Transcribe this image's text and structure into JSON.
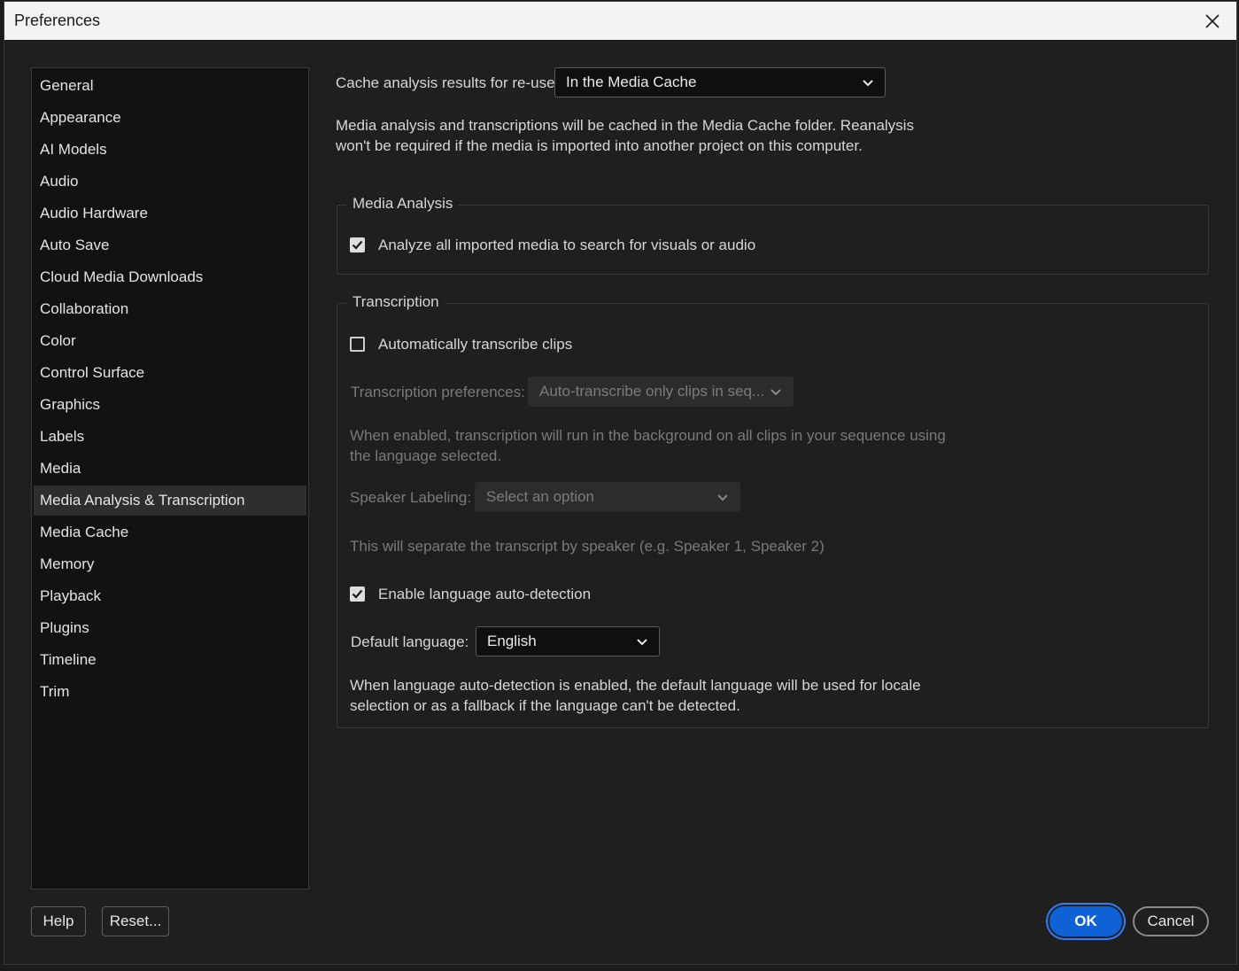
{
  "window": {
    "title": "Preferences"
  },
  "sidebar": {
    "items": [
      {
        "label": "General"
      },
      {
        "label": "Appearance"
      },
      {
        "label": "AI Models"
      },
      {
        "label": "Audio"
      },
      {
        "label": "Audio Hardware"
      },
      {
        "label": "Auto Save"
      },
      {
        "label": "Cloud Media Downloads"
      },
      {
        "label": "Collaboration"
      },
      {
        "label": "Color"
      },
      {
        "label": "Control Surface"
      },
      {
        "label": "Graphics"
      },
      {
        "label": "Labels"
      },
      {
        "label": "Media"
      },
      {
        "label": "Media Analysis & Transcription",
        "selected": true
      },
      {
        "label": "Media Cache"
      },
      {
        "label": "Memory"
      },
      {
        "label": "Playback"
      },
      {
        "label": "Plugins"
      },
      {
        "label": "Timeline"
      },
      {
        "label": "Trim"
      }
    ]
  },
  "cache": {
    "label": "Cache analysis results for re-use:",
    "value": "In the Media Cache",
    "desc": "Media analysis and transcriptions will be cached in the Media Cache folder. Reanalysis won't be required if the media is imported into another project on this computer."
  },
  "media_analysis": {
    "legend": "Media Analysis",
    "analyze_label": "Analyze all imported media to search for visuals or audio",
    "analyze_checked": true
  },
  "transcription": {
    "legend": "Transcription",
    "auto_label": "Automatically transcribe clips",
    "auto_checked": false,
    "prefs_label": "Transcription preferences:",
    "prefs_value": "Auto-transcribe only clips in seq...",
    "prefs_desc": "When enabled, transcription will run in the background on all clips in your sequence using the language selected.",
    "speaker_label": "Speaker Labeling:",
    "speaker_value": "Select an option",
    "speaker_desc": "This will separate the transcript by speaker (e.g. Speaker 1, Speaker 2)",
    "lang_detect_label": "Enable language auto-detection",
    "lang_detect_checked": true,
    "default_lang_label": "Default language:",
    "default_lang_value": "English",
    "lang_desc": "When language auto-detection is enabled, the default language will be used for locale selection or as a fallback if the language can't be detected."
  },
  "footer": {
    "help": "Help",
    "reset": "Reset...",
    "ok": "OK",
    "cancel": "Cancel"
  },
  "colors": {
    "accent": "#0f62d6",
    "background": "#1f1f1f",
    "sidebar_bg": "#121212"
  }
}
